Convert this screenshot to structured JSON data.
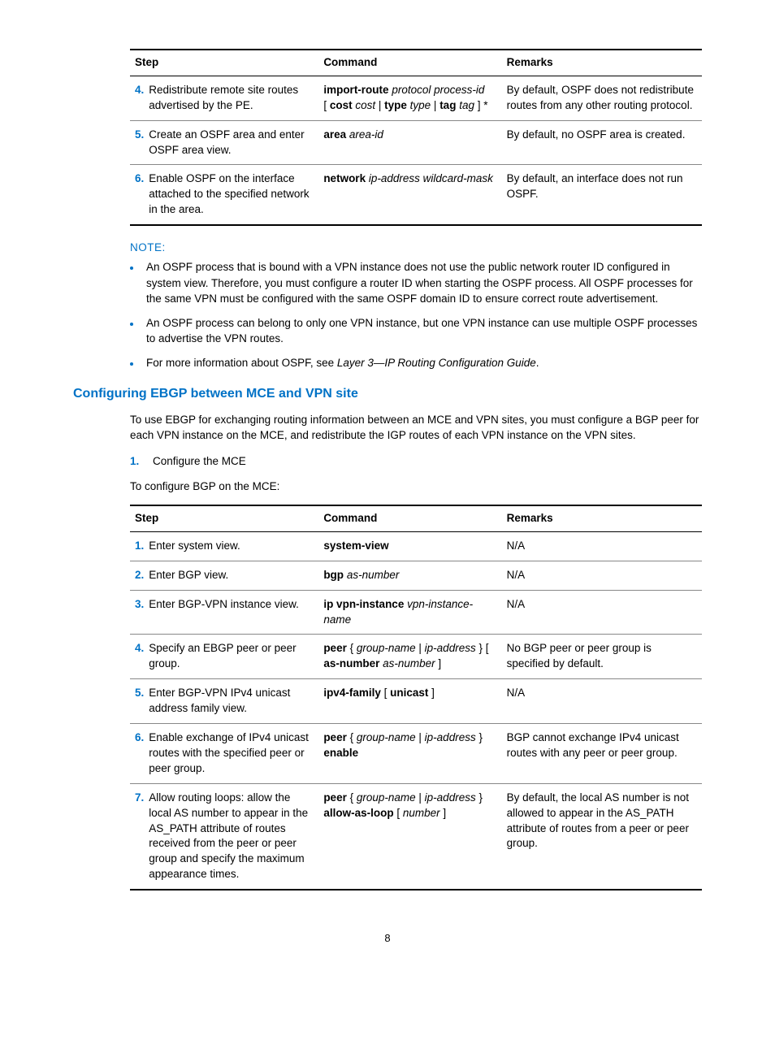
{
  "table1": {
    "headers": {
      "step": "Step",
      "command": "Command",
      "remarks": "Remarks"
    },
    "rows": [
      {
        "num": "4.",
        "step": "Redistribute remote site routes advertised by the PE.",
        "cmd_bold1": "import-route",
        "cmd_ital1": " protocol process-id",
        "cmd_text1": "[ ",
        "cmd_bold2": "cost",
        "cmd_ital2": " cost ",
        "cmd_text2": "| ",
        "cmd_bold3": "type",
        "cmd_ital3": " type ",
        "cmd_text3": "| ",
        "cmd_bold4": "tag",
        "cmd_ital4": " tag ",
        "cmd_text4": "] *",
        "rem": "By default, OSPF does not redistribute routes from any other routing protocol."
      },
      {
        "num": "5.",
        "step": "Create an OSPF area and enter OSPF area view.",
        "cmd_bold1": "area",
        "cmd_ital1": " area-id",
        "rem": "By default, no OSPF area is created."
      },
      {
        "num": "6.",
        "step": "Enable OSPF on the interface attached to the specified network in the area.",
        "cmd_bold1": "network",
        "cmd_ital1": " ip-address wildcard-mask",
        "rem": "By default, an interface does not run OSPF."
      }
    ]
  },
  "note": {
    "label": "NOTE:",
    "items": [
      "An OSPF process that is bound with a VPN instance does not use the public network router ID configured in system view. Therefore, you must configure a router ID when starting the OSPF process. All OSPF processes for the same VPN must be configured with the same OSPF domain ID to ensure correct route advertisement.",
      "An OSPF process can belong to only one VPN instance, but one VPN instance can use multiple OSPF processes to advertise the VPN routes."
    ],
    "item3_pre": "For more information about OSPF, see ",
    "item3_ital": "Layer 3—IP Routing Configuration Guide",
    "item3_post": "."
  },
  "section": {
    "heading": "Configuring EBGP between MCE and VPN site",
    "intro": "To use EBGP for exchanging routing information between an MCE and VPN sites, you must configure a BGP peer for each VPN instance on the MCE, and redistribute the IGP routes of each VPN instance on the VPN sites.",
    "list_num": "1.",
    "list_text": "Configure the MCE",
    "sub": "To configure BGP on the MCE:"
  },
  "table2": {
    "headers": {
      "step": "Step",
      "command": "Command",
      "remarks": "Remarks"
    },
    "rows": [
      {
        "num": "1.",
        "step": "Enter system view.",
        "cmd_b1": "system-view",
        "rem": "N/A"
      },
      {
        "num": "2.",
        "step": "Enter BGP view.",
        "cmd_b1": "bgp",
        "cmd_i1": " as-number",
        "rem": "N/A"
      },
      {
        "num": "3.",
        "step": "Enter BGP-VPN instance view.",
        "cmd_b1": "ip vpn-instance",
        "cmd_i1": " vpn-instance-name",
        "rem": "N/A"
      },
      {
        "num": "4.",
        "step": "Specify an EBGP peer or peer group.",
        "cmd_b1": "peer",
        "cmd_t1": " { ",
        "cmd_i1": "group-name",
        "cmd_t2": " | ",
        "cmd_i2": "ip-address",
        "cmd_t3": " } [ ",
        "cmd_b2": "as-number",
        "cmd_i3": " as-number",
        "cmd_t4": " ]",
        "rem": "No BGP peer or peer group is specified by default."
      },
      {
        "num": "5.",
        "step": "Enter BGP-VPN IPv4 unicast address family view.",
        "cmd_b1": "ipv4-family",
        "cmd_t1": " [ ",
        "cmd_b2": "unicast",
        "cmd_t2": " ]",
        "rem": "N/A"
      },
      {
        "num": "6.",
        "step": "Enable exchange of IPv4 unicast routes with the specified peer or peer group.",
        "cmd_b1": "peer",
        "cmd_t1": " { ",
        "cmd_i1": "group-name",
        "cmd_t2": " | ",
        "cmd_i2": "ip-address",
        "cmd_t3": " } ",
        "cmd_b2": "enable",
        "rem": "BGP cannot exchange IPv4 unicast routes with any peer or peer group."
      },
      {
        "num": "7.",
        "step": "Allow routing loops: allow the local AS number to appear in the AS_PATH attribute of routes received from the peer or peer group and specify the maximum appearance times.",
        "cmd_b1": "peer",
        "cmd_t1": " { ",
        "cmd_i1": "group-name",
        "cmd_t2": " | ",
        "cmd_i2": "ip-address",
        "cmd_t3": " } ",
        "cmd_b2": "allow-as-loop",
        "cmd_t4": " [ ",
        "cmd_i3": "number",
        "cmd_t5": " ]",
        "rem": "By default, the local AS number is not allowed to appear in the AS_PATH attribute of routes from a peer or peer group."
      }
    ]
  },
  "pagenum": "8"
}
